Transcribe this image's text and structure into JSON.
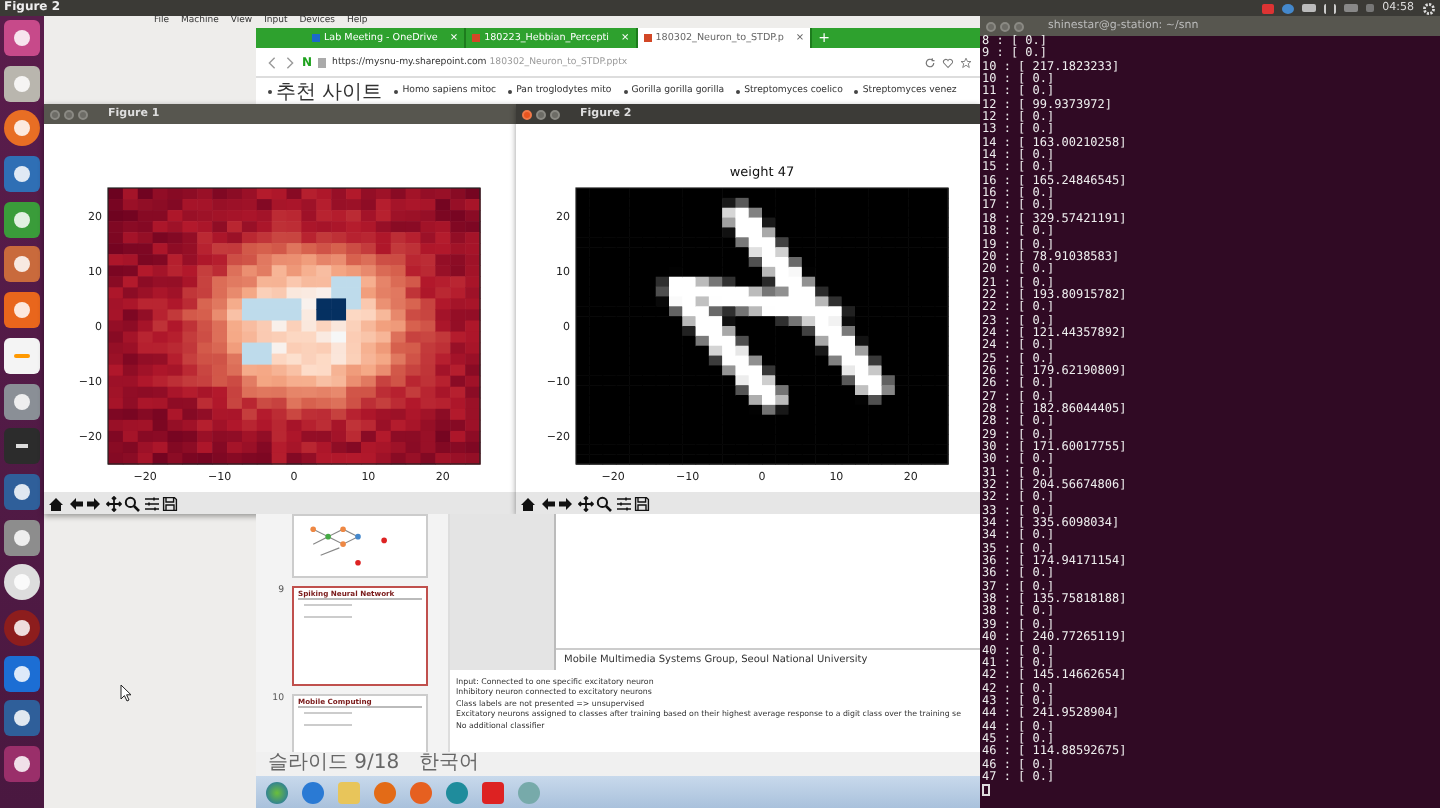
{
  "top_bar": {
    "title": "Figure 2",
    "clock": "04:58"
  },
  "vm_menu": [
    "File",
    "Machine",
    "View",
    "Input",
    "Devices",
    "Help"
  ],
  "browser": {
    "tabs": [
      {
        "label": "Lab Meeting - OneDrive",
        "close": "×",
        "selected": false
      },
      {
        "label": "180223_Hebbian_Percepti",
        "close": "×",
        "selected": false
      },
      {
        "label": "180302_Neuron_to_STDP.p",
        "close": "×",
        "selected": true
      }
    ],
    "new_tab": "+",
    "home_logo": "N",
    "url": "https://mysnu-my.sharepoint.com",
    "url_path": "180302_Neuron_to_STDP.pptx",
    "bookmarks": [
      "추천 사이트",
      "Homo sapiens mitoc",
      "Pan troglodytes mito",
      "Gorilla gorilla gorilla",
      "Streptomyces coelico",
      "Streptomyces venez"
    ]
  },
  "figures": [
    {
      "title": "Figure 1",
      "kind": "rdbu",
      "active": false,
      "xticks": [
        "−20",
        "−10",
        "0",
        "10",
        "20"
      ],
      "yticks": [
        "20",
        "10",
        "0",
        "−10",
        "−20"
      ]
    },
    {
      "title": "Figure 2",
      "plot_title": "weight 47",
      "kind": "gray",
      "active": true,
      "xticks": [
        "−20",
        "−10",
        "0",
        "10",
        "20"
      ],
      "yticks": [
        "20",
        "10",
        "0",
        "−10",
        "−20"
      ]
    }
  ],
  "presentation": {
    "slides": [
      {
        "kind": "diagram",
        "selected": false
      },
      {
        "kind": "bullets",
        "number": "9",
        "title": "Spiking Neural Network",
        "selected": true
      },
      {
        "kind": "bullets",
        "number": "10",
        "title": "Mobile Computing",
        "selected": false
      }
    ],
    "footer": "Mobile Multimedia Systems Group, Seoul National University",
    "notes": [
      "Input: Connected to one specific excitatory neuron",
      "Inhibitory neuron connected to excitatory neurons",
      "Class labels are not presented => unsupervised",
      "Excitatory neurons assigned to classes after training based on their highest average response to a digit class over the training se",
      "No additional classifier"
    ],
    "status": [
      "슬라이드 9/18",
      "한국어"
    ]
  },
  "terminal": {
    "title": "shinestar@g-station: ~/snn",
    "lines": [
      "8 : [ 0.]",
      "9 : [ 0.]",
      "10 : [ 217.1823233]",
      "10 : [ 0.]",
      "11 : [ 0.]",
      "12 : [ 99.9373972]",
      "12 : [ 0.]",
      "13 : [ 0.]",
      "14 : [ 163.00210258]",
      "14 : [ 0.]",
      "15 : [ 0.]",
      "16 : [ 165.24846545]",
      "16 : [ 0.]",
      "17 : [ 0.]",
      "18 : [ 329.57421191]",
      "18 : [ 0.]",
      "19 : [ 0.]",
      "20 : [ 78.91038583]",
      "20 : [ 0.]",
      "21 : [ 0.]",
      "22 : [ 193.80915782]",
      "22 : [ 0.]",
      "23 : [ 0.]",
      "24 : [ 121.44357892]",
      "24 : [ 0.]",
      "25 : [ 0.]",
      "26 : [ 179.62190809]",
      "26 : [ 0.]",
      "27 : [ 0.]",
      "28 : [ 182.86044405]",
      "28 : [ 0.]",
      "29 : [ 0.]",
      "30 : [ 171.60017755]",
      "30 : [ 0.]",
      "31 : [ 0.]",
      "32 : [ 204.56674806]",
      "32 : [ 0.]",
      "33 : [ 0.]",
      "34 : [ 335.6098034]",
      "34 : [ 0.]",
      "35 : [ 0.]",
      "36 : [ 174.94171154]",
      "36 : [ 0.]",
      "37 : [ 0.]",
      "38 : [ 135.75818188]",
      "38 : [ 0.]",
      "39 : [ 0.]",
      "40 : [ 240.77265119]",
      "40 : [ 0.]",
      "41 : [ 0.]",
      "42 : [ 145.14662654]",
      "42 : [ 0.]",
      "43 : [ 0.]",
      "44 : [ 241.9528904]",
      "44 : [ 0.]",
      "45 : [ 0.]",
      "46 : [ 114.88592675]",
      "46 : [ 0.]",
      "47 : [ 0.]"
    ]
  }
}
